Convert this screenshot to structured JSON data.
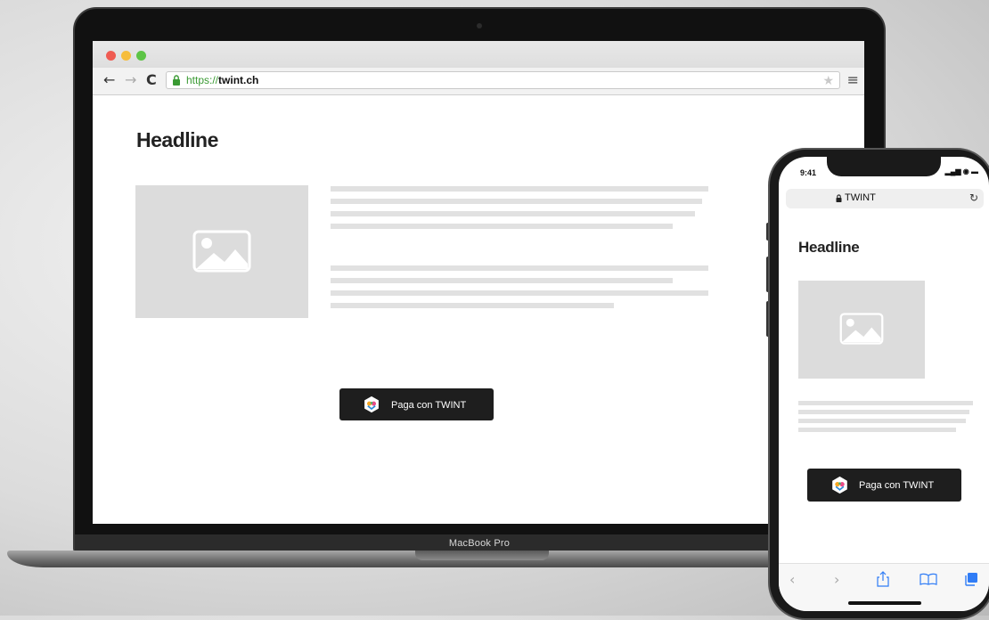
{
  "laptop": {
    "device_label": "MacBook Pro",
    "browser": {
      "url_scheme": "https://",
      "url_host": "twint.ch"
    },
    "page": {
      "headline": "Headline",
      "pay_button_label": "Paga con TWINT"
    }
  },
  "phone": {
    "status_time": "9:41",
    "status_icons": "▂▄▆ ◉ ▬",
    "url_text": "TWINT",
    "page": {
      "headline": "Headline",
      "pay_button_label": "Paga con TWINT"
    }
  },
  "colors": {
    "button_bg": "#1e1e1e",
    "placeholder_gray": "#dcdcdc",
    "ios_accent": "#2f7cf6",
    "secure_green": "#3a9a33"
  }
}
